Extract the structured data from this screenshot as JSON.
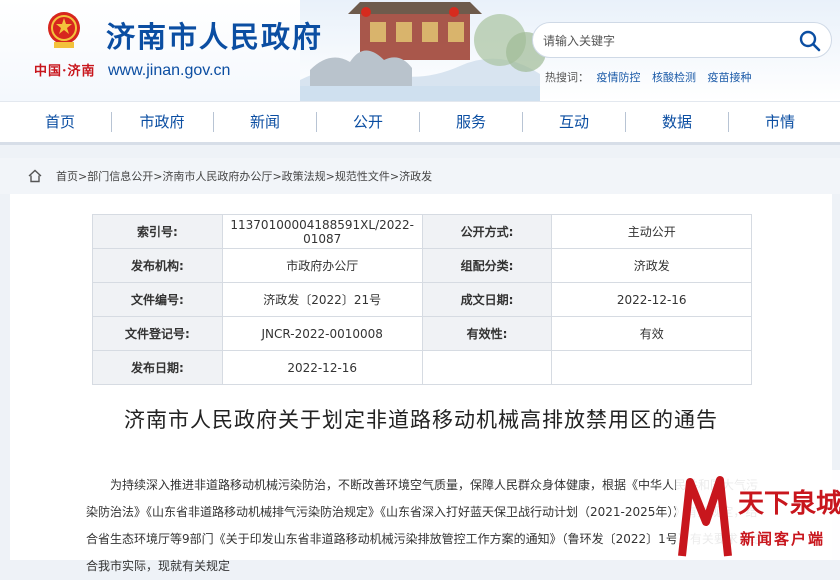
{
  "header": {
    "site_title": "济南市人民政府",
    "site_url": "www.jinan.gov.cn",
    "city_logo": "中国·济南",
    "search_placeholder": "请输入关键字",
    "hot_label": "热搜词：",
    "hotwords": [
      "疫情防控",
      "核酸检测",
      "疫苗接种"
    ]
  },
  "nav": [
    "首页",
    "市政府",
    "新闻",
    "公开",
    "服务",
    "互动",
    "数据",
    "市情"
  ],
  "breadcrumb": [
    "首页",
    "部门信息公开",
    "济南市人民政府办公厅",
    "政策法规",
    "规范性文件",
    "济政发"
  ],
  "meta": {
    "index_label": "索引号:",
    "index_value": "11370100004188591XL/2022-01087",
    "open_label": "公开方式:",
    "open_value": "主动公开",
    "org_label": "发布机构:",
    "org_value": "市政府办公厅",
    "category_label": "组配分类:",
    "category_value": "济政发",
    "docno_label": "文件编号:",
    "docno_value": "济政发〔2022〕21号",
    "date_label": "成文日期:",
    "date_value": "2022-12-16",
    "regno_label": "文件登记号:",
    "regno_value": "JNCR-2022-0010008",
    "validity_label": "有效性:",
    "validity_value": "有效",
    "pub_label": "发布日期:",
    "pub_value": "2022-12-16"
  },
  "document": {
    "title": "济南市人民政府关于划定非道路移动机械高排放禁用区的通告",
    "paragraph": "为持续深入推进非道路移动机械污染防治，不断改善环境空气质量，保障人民群众身体健康，根据《中华人民共和国大气污染防治法》《山东省非道路移动机械排气污染防治规定》《山东省深入打好蓝天保卫战行动计划（2021-2025年）》有关规定，结合省生态环境厅等9部门《关于印发山东省非道路移动机械污染排放管控工作方案的通知》（鲁环发〔2022〕1号）有关要求，结合我市实际，现就有关规定"
  },
  "watermark": {
    "line1": "天下泉城",
    "line2": "新闻客户端"
  },
  "colors": {
    "brand_blue": "#0b4ea2",
    "brand_red": "#c8161d"
  }
}
